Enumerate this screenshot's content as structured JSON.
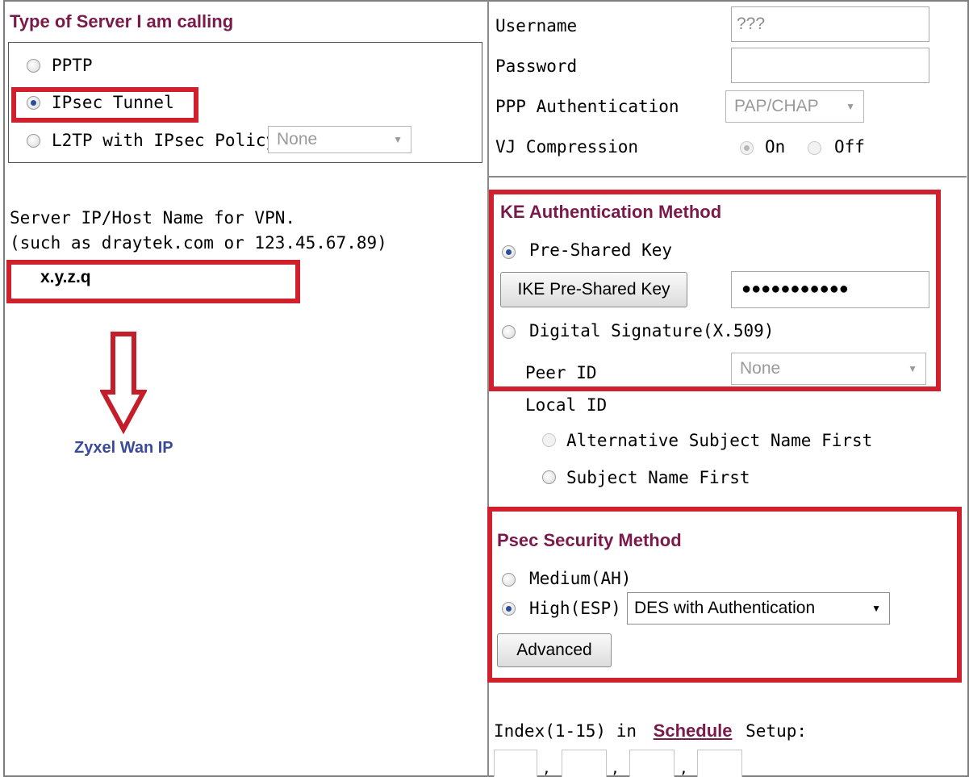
{
  "left": {
    "server_type_heading": "Type of Server I am calling",
    "options": [
      {
        "label": "PPTP",
        "selected": false
      },
      {
        "label": "IPsec Tunnel",
        "selected": true
      },
      {
        "label": "L2TP with IPsec Policy",
        "selected": false
      }
    ],
    "l2tp_policy_value": "None",
    "server_ip_label_line1": "Server IP/Host Name for VPN.",
    "server_ip_label_line2": "(such as draytek.com or 123.45.67.89)",
    "server_ip_value": "x.y.z.q",
    "annotation_text": "Zyxel Wan IP"
  },
  "right": {
    "username_label": "Username",
    "username_value": "???",
    "password_label": "Password",
    "password_value": "",
    "ppp_auth_label": "PPP Authentication",
    "ppp_auth_value": "PAP/CHAP",
    "vj_label": "VJ Compression",
    "vj_on_label": "On",
    "vj_off_label": "Off",
    "vj_value": "On",
    "ike_heading": "KE Authentication Method",
    "pre_shared_label": "Pre-Shared Key",
    "ike_psk_button": "IKE Pre-Shared Key",
    "psk_value": "●●●●●●●●●●●",
    "digital_sig_label": "Digital Signature(X.509)",
    "peer_id_label": "Peer ID",
    "peer_id_value": "None",
    "local_id_label": "Local ID",
    "alt_subject_label": "Alternative Subject Name First",
    "subject_label": "Subject Name First",
    "ipsec_heading": "Psec Security Method",
    "medium_label": "Medium(AH)",
    "high_label": "High(ESP)",
    "high_selected": true,
    "esp_value": "DES with Authentication",
    "advanced_button": "Advanced",
    "index_prefix": "Index(1-15) in",
    "schedule_link": "Schedule",
    "index_suffix": "Setup:",
    "schedule_separators": [
      ",",
      ",",
      ","
    ]
  },
  "colors": {
    "highlight": "#d0202e",
    "heading": "#7a1a4a",
    "annotation": "#3a4a9a"
  }
}
